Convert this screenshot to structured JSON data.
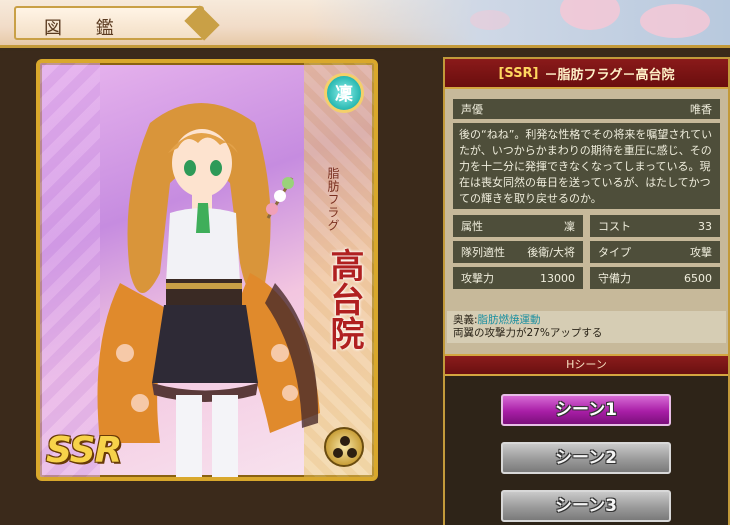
{
  "header": {
    "title": "図 鑑"
  },
  "card": {
    "attribute_badge": "凜",
    "title_vertical": "脂肪フラグ",
    "name_vertical": "高台院",
    "rarity_label": "SSR",
    "crest_icon": "family-crest-icon"
  },
  "info": {
    "rarity_tag": "[SSR]",
    "name": "－脂肪フラグ－高台院",
    "voice_label": "声優",
    "voice_value": "唯香",
    "description": "後の“ねね”。利発な性格でその将来を嘱望されていたが、いつからかまわりの期待を重圧に感じ、その力を十二分に発揮できなくなってしまっている。現在は喪女同然の毎日を送っているが、はたしてかつての輝きを取り戻せるのか。",
    "stats": [
      {
        "label": "属性",
        "value": "凜"
      },
      {
        "label": "コスト",
        "value": "33"
      },
      {
        "label": "隊列適性",
        "value": "後衛/大将"
      },
      {
        "label": "タイプ",
        "value": "攻撃"
      },
      {
        "label": "攻撃力",
        "value": "13000"
      },
      {
        "label": "守備力",
        "value": "6500"
      }
    ],
    "ougi_label": "奥義:",
    "ougi_name": "脂肪燃焼運動",
    "ougi_desc": "両翼の攻撃力が27%アップする"
  },
  "hscene": {
    "header": "Hシーン",
    "buttons": [
      "シーン1",
      "シーン2",
      "シーン3"
    ]
  },
  "colors": {
    "accent_gold": "#c29a3a",
    "name_bar": "#7a1414",
    "active_scene": "#a81ea6"
  }
}
